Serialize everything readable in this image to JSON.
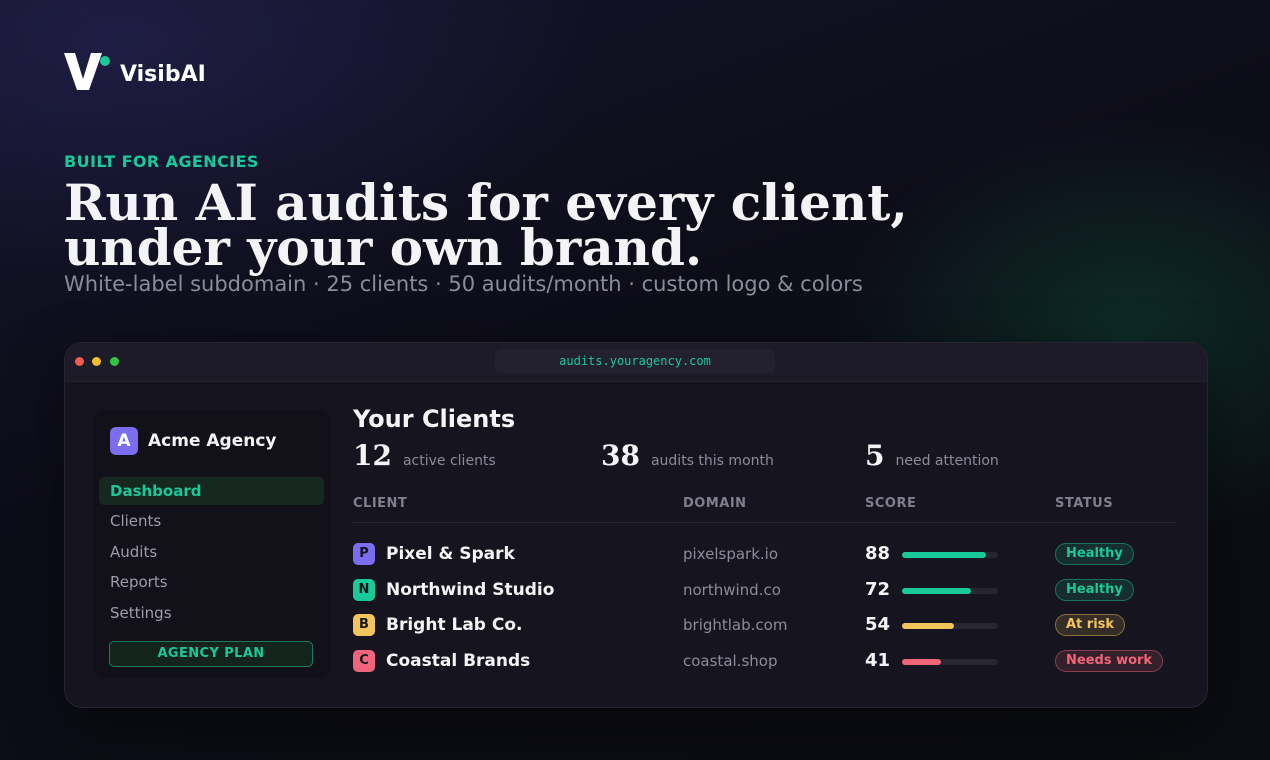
{
  "brand": {
    "name": "VisibAI",
    "accent": "#19c999"
  },
  "hero": {
    "eyebrow": "BUILT FOR AGENCIES",
    "headline_line1": "Run AI audits for every client,",
    "headline_line2": "under your own brand.",
    "subline": "White-label subdomain · 25 clients · 50 audits/month · custom logo & colors"
  },
  "browser": {
    "url": "audits.youragency.com"
  },
  "sidebar": {
    "agency_initial": "A",
    "agency_name": "Acme Agency",
    "items": [
      {
        "label": "Dashboard",
        "active": true
      },
      {
        "label": "Clients",
        "active": false
      },
      {
        "label": "Audits",
        "active": false
      },
      {
        "label": "Reports",
        "active": false
      },
      {
        "label": "Settings",
        "active": false
      }
    ],
    "plan_label": "AGENCY PLAN"
  },
  "main": {
    "title": "Your Clients",
    "stats": [
      {
        "value": "12",
        "label": "active clients"
      },
      {
        "value": "38",
        "label": "audits this month"
      },
      {
        "value": "5",
        "label": "need attention"
      }
    ],
    "columns": [
      "CLIENT",
      "DOMAIN",
      "SCORE",
      "STATUS"
    ],
    "rows": [
      {
        "initial": "P",
        "name": "Pixel & Spark",
        "domain": "pixelspark.io",
        "score": 88,
        "status": "Healthy",
        "badge_color": "#7b6cf0",
        "bar_color": "#19c999",
        "status_color": "#19c999"
      },
      {
        "initial": "N",
        "name": "Northwind Studio",
        "domain": "northwind.co",
        "score": 72,
        "status": "Healthy",
        "badge_color": "#19c999",
        "bar_color": "#19c999",
        "status_color": "#19c999"
      },
      {
        "initial": "B",
        "name": "Bright Lab Co.",
        "domain": "brightlab.com",
        "score": 54,
        "status": "At risk",
        "badge_color": "#f2c55c",
        "bar_color": "#f2c55c",
        "status_color": "#f2c55c"
      },
      {
        "initial": "C",
        "name": "Coastal Brands",
        "domain": "coastal.shop",
        "score": 41,
        "status": "Needs work",
        "badge_color": "#f0657a",
        "bar_color": "#f0657a",
        "status_color": "#f0657a"
      }
    ]
  }
}
